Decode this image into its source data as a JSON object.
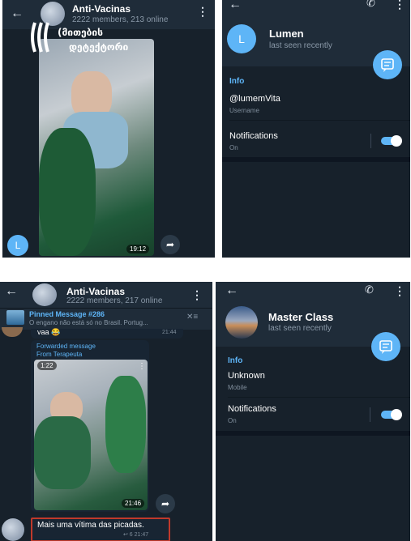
{
  "top_left": {
    "header": {
      "title": "Anti-Vacinas",
      "subtitle": "2222 members, 213 online"
    },
    "watermark_logo": "მითების დეტექტორი",
    "video_time": "19:12",
    "user_avatar_letter": "L"
  },
  "top_right": {
    "name": "Lumen",
    "status": "last seen recently",
    "avatar_letter": "L",
    "info_label": "Info",
    "username_value": "@lumemVita",
    "username_caption": "Username",
    "notifications_label": "Notifications",
    "notifications_state": "On"
  },
  "bottom_left": {
    "header": {
      "title": "Anti-Vacinas",
      "subtitle": "2222 members, 217 online"
    },
    "pinned": {
      "title": "Pinned Message #286",
      "text": "O engano não está só no Brasil. Portug..."
    },
    "prev_message": {
      "text": "vaa 😂",
      "time": "21:44"
    },
    "forwarded": {
      "label": "Forwarded message",
      "from": "From Terapeuta"
    },
    "video_duration": "1:22",
    "video_time": "21:46",
    "message": {
      "text": "Mais uma vítima das picadas.",
      "meta": "↩ 6 21:47"
    },
    "highlight_color": "#c0392b"
  },
  "bottom_right": {
    "name": "Master Class",
    "status": "last seen recently",
    "info_label": "Info",
    "phone_value": "Unknown",
    "phone_caption": "Mobile",
    "notifications_label": "Notifications",
    "notifications_state": "On"
  }
}
